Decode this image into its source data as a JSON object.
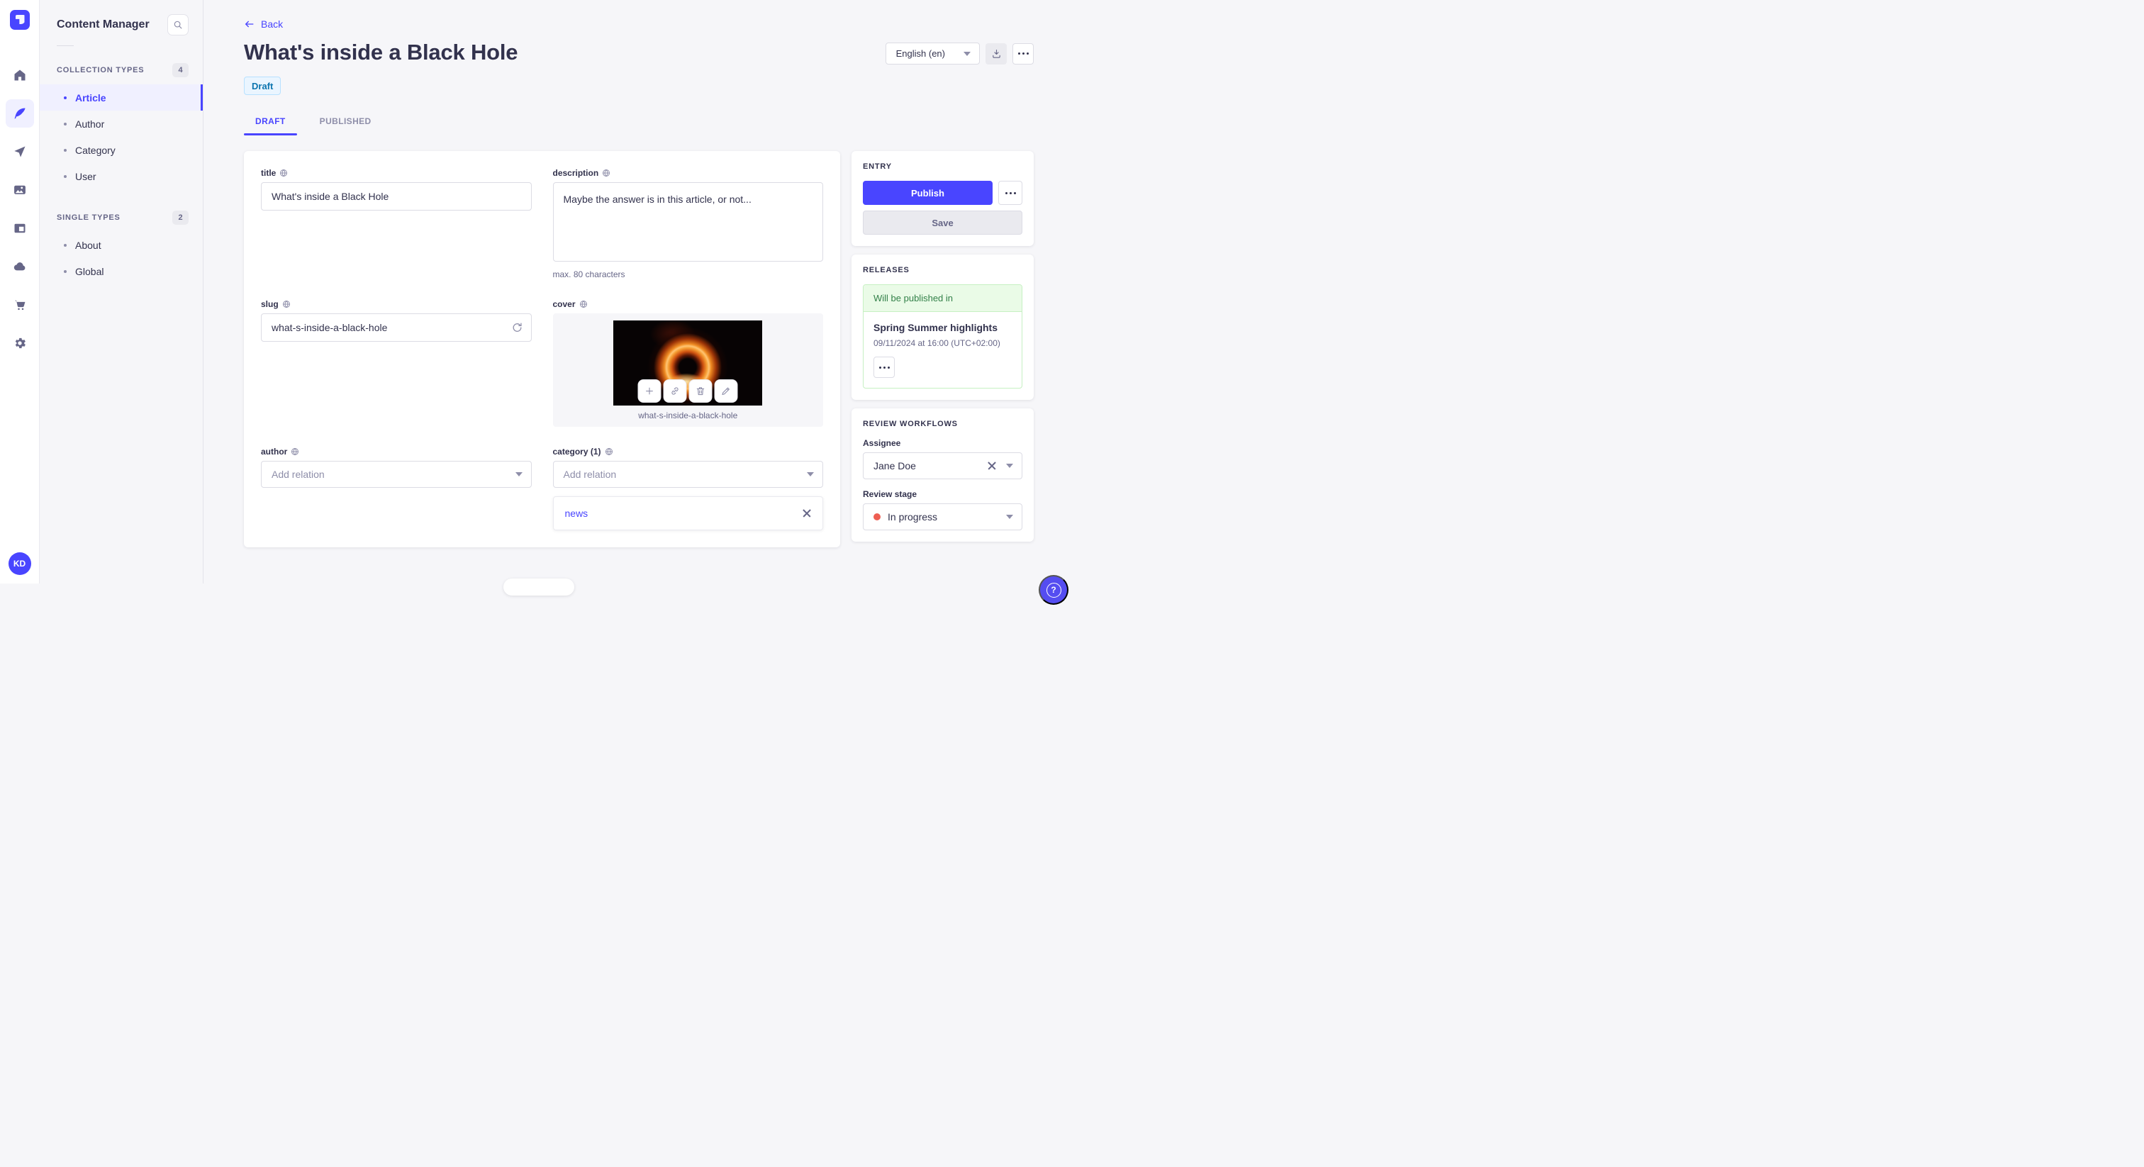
{
  "theme": {
    "primary": "#4945ff",
    "draft_text": "#0c75af",
    "success_text": "#328048",
    "stage_dot": "#ee5e52"
  },
  "nav_rail": {
    "user_initials": "KD",
    "items": [
      "home",
      "content-manager",
      "releases",
      "media-library",
      "content-type-builder",
      "deploy",
      "marketplace",
      "settings"
    ]
  },
  "subnav": {
    "title": "Content Manager",
    "sections": [
      {
        "label": "COLLECTION TYPES",
        "count": "4",
        "items": [
          {
            "label": "Article"
          },
          {
            "label": "Author"
          },
          {
            "label": "Category"
          },
          {
            "label": "User"
          }
        ]
      },
      {
        "label": "SINGLE TYPES",
        "count": "2",
        "items": [
          {
            "label": "About"
          },
          {
            "label": "Global"
          }
        ]
      }
    ]
  },
  "header": {
    "back_label": "Back",
    "title": "What's inside a Black Hole",
    "status_badge": "Draft",
    "language": "English (en)"
  },
  "tabs": {
    "items": [
      {
        "label": "DRAFT"
      },
      {
        "label": "PUBLISHED"
      }
    ]
  },
  "form": {
    "title": {
      "label": "title",
      "value": "What's inside a Black Hole"
    },
    "description": {
      "label": "description",
      "value": "Maybe the answer is in this article, or not...",
      "hint": "max. 80 characters"
    },
    "slug": {
      "label": "slug",
      "value": "what-s-inside-a-black-hole"
    },
    "cover": {
      "label": "cover",
      "caption": "what-s-inside-a-black-hole"
    },
    "author": {
      "label": "author",
      "placeholder": "Add relation"
    },
    "category": {
      "label": "category (1)",
      "placeholder": "Add relation",
      "relations": [
        {
          "name": "news"
        }
      ]
    }
  },
  "entry_panel": {
    "title": "ENTRY",
    "publish_label": "Publish",
    "save_label": "Save"
  },
  "releases_panel": {
    "title": "RELEASES",
    "banner": "Will be published in",
    "release_name": "Spring Summer highlights",
    "release_date": "09/11/2024 at 16:00 (UTC+02:00)"
  },
  "review_panel": {
    "title": "REVIEW WORKFLOWS",
    "assignee_label": "Assignee",
    "assignee_value": "Jane Doe",
    "stage_label": "Review stage",
    "stage_value": "In progress"
  }
}
